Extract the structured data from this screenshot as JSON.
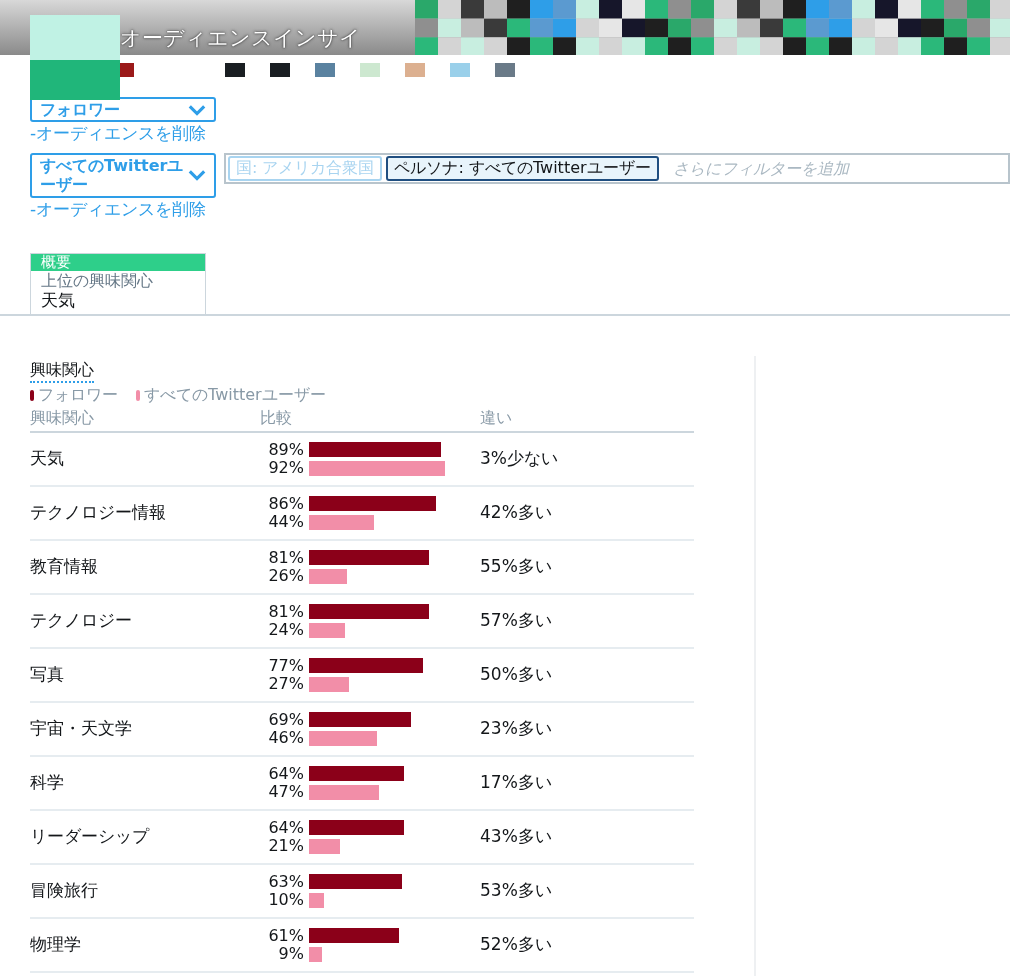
{
  "header": {
    "title": "オーディエンスインサイ"
  },
  "audiences": [
    {
      "dropdown": "フォロワー",
      "remove_link": "-オーディエンスを削除"
    },
    {
      "dropdown": "すべてのTwitterユーザー",
      "remove_link": "-オーディエンスを削除"
    }
  ],
  "filters": {
    "chips": [
      {
        "label": "国: アメリカ合衆国",
        "disabled": true
      },
      {
        "label": "ペルソナ: すべてのTwitterユーザー",
        "disabled": false
      }
    ],
    "placeholder": "さらにフィルターを追加"
  },
  "tab": {
    "title": "概要",
    "subtitle": "上位の興味関心",
    "value": "天気"
  },
  "section": {
    "title": "興味関心",
    "legend": [
      {
        "label": "フォロワー",
        "color": "#8b0019"
      },
      {
        "label": "すべてのTwitterユーザー",
        "color": "#f28ea8"
      }
    ],
    "columns": [
      "興味関心",
      "比較",
      "違い"
    ],
    "rows": [
      {
        "name": "天気",
        "followers": {
          "value": "89%"
        },
        "all_users": {
          "value": "92%"
        },
        "diff": "3%少ない"
      },
      {
        "name": "テクノロジー情報",
        "followers": {
          "value": "86%"
        },
        "all_users": {
          "value": "44%"
        },
        "diff": "42%多い"
      },
      {
        "name": "教育情報",
        "followers": {
          "value": "81%"
        },
        "all_users": {
          "value": "26%"
        },
        "diff": "55%多い"
      },
      {
        "name": "テクノロジー",
        "followers": {
          "value": "81%"
        },
        "all_users": {
          "value": "24%"
        },
        "diff": "57%多い"
      },
      {
        "name": "写真",
        "followers": {
          "value": "77%"
        },
        "all_users": {
          "value": "27%"
        },
        "diff": "50%多い"
      },
      {
        "name": "宇宙・天文学",
        "followers": {
          "value": "69%"
        },
        "all_users": {
          "value": "46%"
        },
        "diff": "23%多い"
      },
      {
        "name": "科学",
        "followers": {
          "value": "64%"
        },
        "all_users": {
          "value": "47%"
        },
        "diff": "17%多い"
      },
      {
        "name": "リーダーシップ",
        "followers": {
          "value": "64%"
        },
        "all_users": {
          "value": "21%"
        },
        "diff": "43%多い"
      },
      {
        "name": "冒険旅行",
        "followers": {
          "value": "63%"
        },
        "all_users": {
          "value": "10%"
        },
        "diff": "53%多い"
      },
      {
        "name": "物理学",
        "followers": {
          "value": "61%"
        },
        "all_users": {
          "value": "9%"
        },
        "diff": "52%多い"
      }
    ]
  }
}
